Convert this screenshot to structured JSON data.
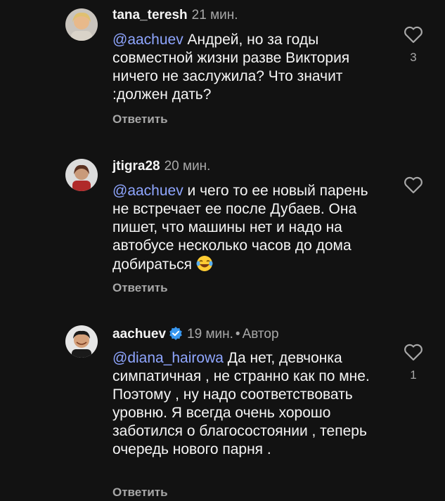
{
  "comments": [
    {
      "username": "tana_teresh",
      "time": "21 мин.",
      "mention": "@aachuev",
      "text": " Андрей, но за годы совместной жизни разве Виктория ничего не заслужила? Что значит :должен дать?",
      "reply_label": "Ответить",
      "like_count": "3",
      "avatar": "woman-photo-avatar",
      "like_icon": "heart-outline-icon"
    },
    {
      "username": "jtigra28",
      "time": "20 мин.",
      "mention": "@aachuev",
      "text": " и чего то ее новый парень не встречает ее после Дубаев. Она пишет, что машины нет и надо на автобусе несколько часов до дома добираться",
      "emoji": "laughing-tears-emoji",
      "reply_label": "Ответить",
      "like_count": "",
      "avatar": "woman-photo-avatar",
      "like_icon": "heart-outline-icon"
    },
    {
      "username": "aachuev",
      "time": "19 мин.",
      "separator": "•",
      "author_label": "Автор",
      "verified_color": "#3897f0",
      "mention": "@diana_hairowa",
      "text": "  Да нет, девчонка симпатичная , не странно как по мне. Поэтому , ну надо соответствовать уровню. Я всегда очень хорошо заботился о благосостоянии , теперь очередь нового парня .",
      "reply_label": "Ответить",
      "like_count": "1",
      "avatar": "man-photo-avatar",
      "like_icon": "heart-outline-icon"
    }
  ],
  "colors": {
    "background": "#121212",
    "text": "#f5f5f5",
    "secondary": "#a8a8a8",
    "mention": "#8fa6ff"
  }
}
